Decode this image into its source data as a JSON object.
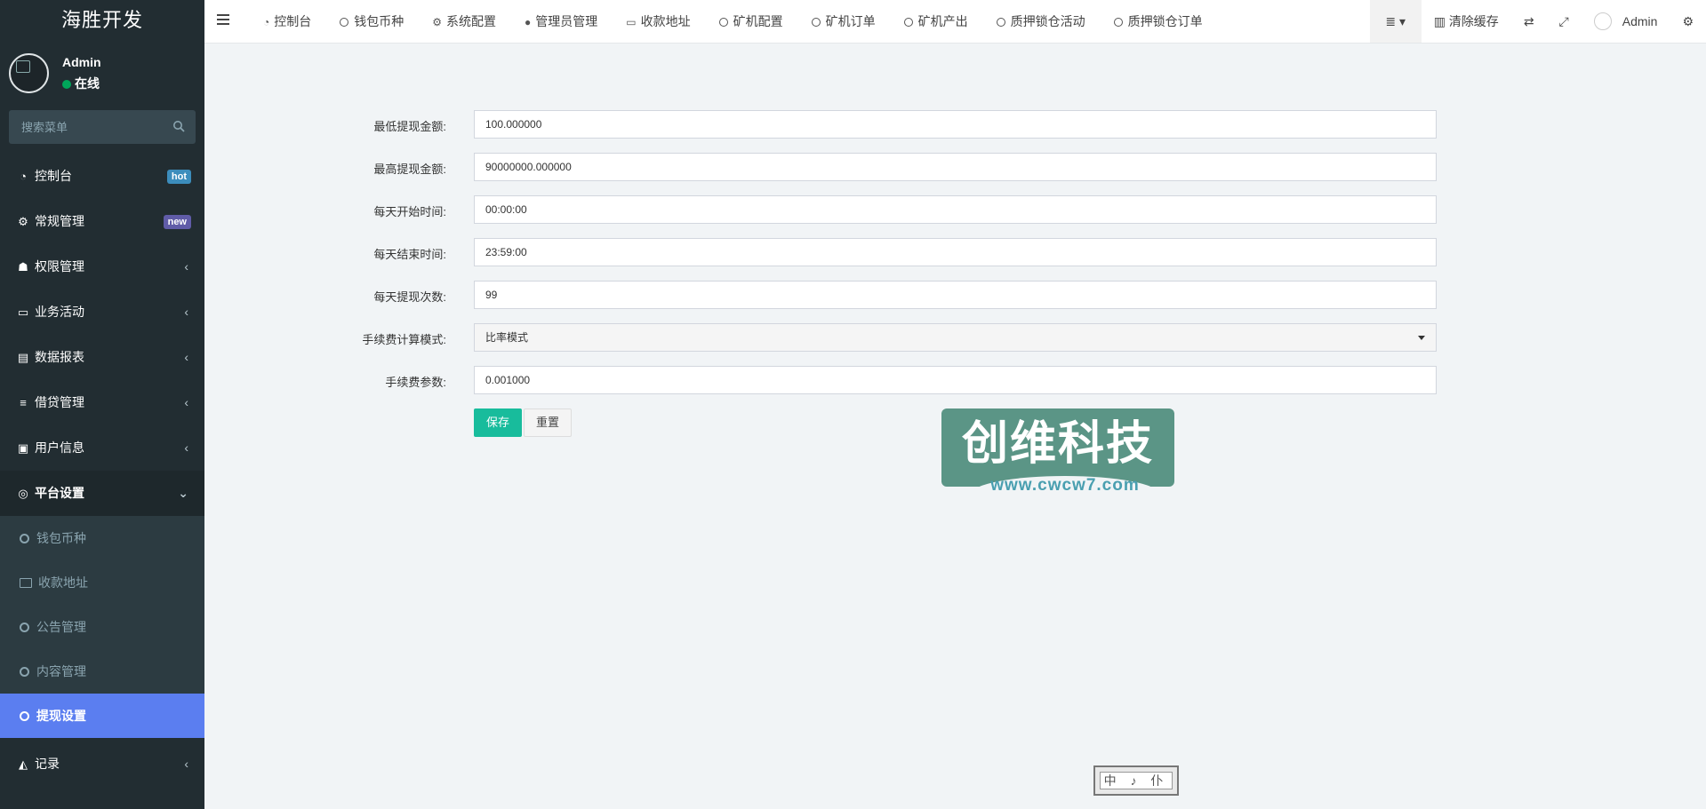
{
  "app": {
    "title": "海胜开发"
  },
  "user": {
    "name": "Admin",
    "status": "在线"
  },
  "search": {
    "placeholder": "搜索菜单"
  },
  "sidebar": {
    "items": [
      {
        "label": "控制台",
        "icon": "dashboard-icon",
        "badge": "hot"
      },
      {
        "label": "常规管理",
        "icon": "cogs-icon",
        "badge": "new"
      },
      {
        "label": "权限管理",
        "icon": "group-icon"
      },
      {
        "label": "业务活动",
        "icon": "id-card-icon"
      },
      {
        "label": "数据报表",
        "icon": "file-icon"
      },
      {
        "label": "借贷管理",
        "icon": "list-icon"
      },
      {
        "label": "用户信息",
        "icon": "address-book-icon"
      },
      {
        "label": "平台设置",
        "icon": "cog-icon"
      }
    ],
    "submenu": [
      {
        "label": "钱包币种",
        "icon": "circle-icon"
      },
      {
        "label": "收款地址",
        "icon": "id-card-icon"
      },
      {
        "label": "公告管理",
        "icon": "circle-icon"
      },
      {
        "label": "内容管理",
        "icon": "circle-icon"
      },
      {
        "label": "提现设置",
        "icon": "circle-icon"
      }
    ],
    "last_item": {
      "label": "记录",
      "icon": "area-chart-icon"
    }
  },
  "tabs": [
    {
      "label": "控制台",
      "icon": "dashboard-icon"
    },
    {
      "label": "钱包币种",
      "icon": "circle-icon"
    },
    {
      "label": "系统配置",
      "icon": "cog-icon"
    },
    {
      "label": "管理员管理",
      "icon": "user-icon"
    },
    {
      "label": "收款地址",
      "icon": "id-card-icon"
    },
    {
      "label": "矿机配置",
      "icon": "circle-icon"
    },
    {
      "label": "矿机订单",
      "icon": "circle-icon"
    },
    {
      "label": "矿机产出",
      "icon": "circle-icon"
    },
    {
      "label": "质押锁仓活动",
      "icon": "circle-icon"
    },
    {
      "label": "质押锁仓订单",
      "icon": "circle-icon"
    }
  ],
  "navbar_right": {
    "clear_cache": "清除缓存",
    "user": "Admin"
  },
  "form": {
    "fields": [
      {
        "label": "最低提现金额:",
        "value": "100.000000"
      },
      {
        "label": "最高提现金额:",
        "value": "90000000.000000"
      },
      {
        "label": "每天开始时间:",
        "value": "00:00:00"
      },
      {
        "label": "每天结束时间:",
        "value": "23:59:00"
      },
      {
        "label": "每天提现次数:",
        "value": "99"
      },
      {
        "label": "手续费计算模式:",
        "value": "比率模式"
      },
      {
        "label": "手续费参数:",
        "value": "0.001000"
      }
    ],
    "save_label": "保存",
    "reset_label": "重置"
  },
  "watermark": {
    "text": "创维科技",
    "url": "www.cwcw7.com"
  },
  "bottom_widget": {
    "text": "中 ♪ 仆"
  },
  "colors": {
    "sidebar_bg": "#222d32",
    "active_item": "#5b7ef0",
    "save_button": "#18bc9c",
    "badge_hot": "#3c8dbc",
    "badge_new": "#605ca8"
  }
}
